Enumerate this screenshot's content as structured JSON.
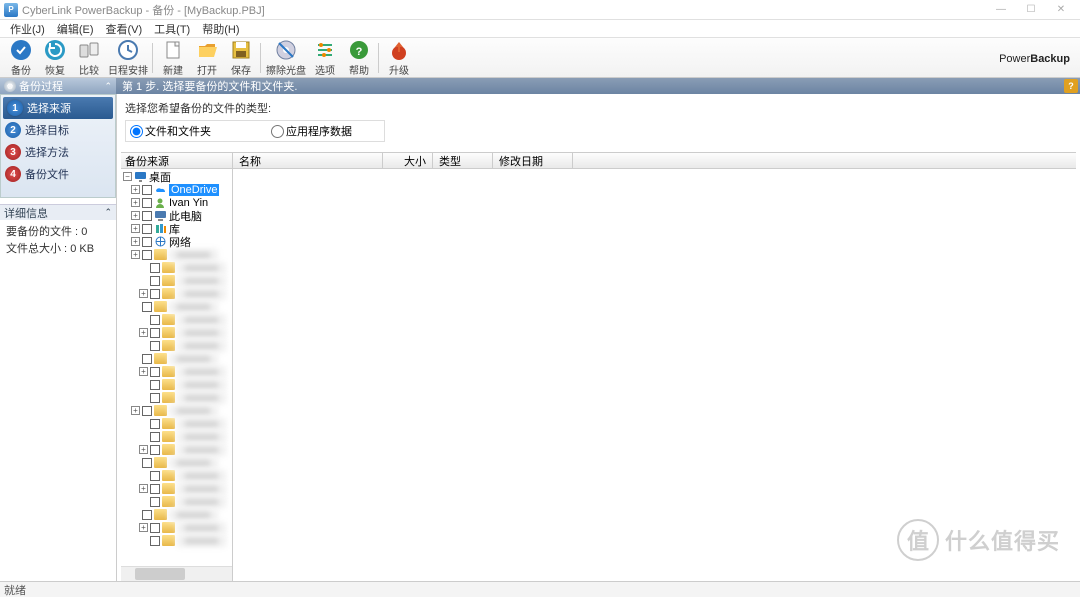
{
  "window": {
    "title": "CyberLink PowerBackup - 备份 - [MyBackup.PBJ]"
  },
  "menu": {
    "items": [
      "作业(J)",
      "编辑(E)",
      "查看(V)",
      "工具(T)",
      "帮助(H)"
    ]
  },
  "toolbar": {
    "backup": "备份",
    "restore": "恢复",
    "compare": "比较",
    "schedule": "日程安排",
    "new": "新建",
    "open": "打开",
    "save": "保存",
    "erase": "擦除光盘",
    "options": "选项",
    "help": "帮助",
    "upgrade": "升级"
  },
  "brand": "PowerBackup",
  "stepbar": "第 1 步. 选择要备份的文件和文件夹.",
  "sidebar": {
    "proc_header": "备份过程",
    "steps": [
      "选择来源",
      "选择目标",
      "选择方法",
      "备份文件"
    ],
    "detail_header": "详细信息",
    "detail_line1_label": "要备份的文件 :",
    "detail_line1_value": "0",
    "detail_line2_label": "文件总大小 :",
    "detail_line2_value": "0 KB"
  },
  "content": {
    "choose_label": "选择您希望备份的文件的类型:",
    "radio_files": "文件和文件夹",
    "radio_app": "应用程序数据",
    "tree_header": "备份来源",
    "list_cols": {
      "name": "名称",
      "size": "大小",
      "type": "类型",
      "date": "修改日期"
    },
    "tree": {
      "root": "桌面",
      "nodes": [
        {
          "label": "OneDrive",
          "icon": "onedrive",
          "selected": true,
          "exp": "+"
        },
        {
          "label": "Ivan Yin",
          "icon": "user",
          "exp": "+"
        },
        {
          "label": "此电脑",
          "icon": "pc",
          "exp": "+"
        },
        {
          "label": "库",
          "icon": "lib",
          "exp": "+"
        },
        {
          "label": "网络",
          "icon": "net",
          "exp": "+"
        }
      ],
      "blurred_count": 23
    }
  },
  "status": "就绪",
  "watermark": "什么值得买"
}
